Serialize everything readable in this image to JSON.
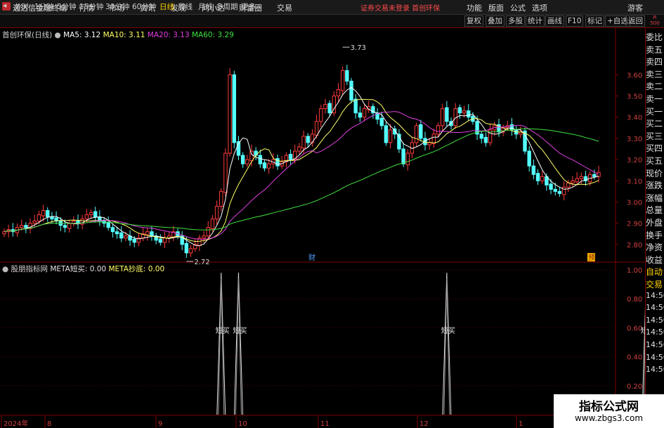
{
  "app": {
    "title": "通达信金融终端"
  },
  "menu": [
    "行情",
    "市场",
    "资讯",
    "发现",
    "问小达",
    "财富圈",
    "交易"
  ],
  "warning": "证券交易未登录  首创环保",
  "right_menu": [
    "功能",
    "版面",
    "公式",
    "选项",
    "游客"
  ],
  "toolbar": {
    "periods": [
      "分时",
      "1分钟",
      "5分钟",
      "15分钟",
      "30分钟",
      "60分钟",
      "日线",
      "周线",
      "月线",
      "多周期",
      "更多"
    ],
    "active": "日线",
    "right": [
      "复权",
      "叠加",
      "多股",
      "统计",
      "画线",
      "F10",
      "标记",
      "+自选",
      "返回"
    ]
  },
  "corner": {
    "line1": "R",
    "line2": "500"
  },
  "stock": {
    "name": "首创环保(日线)"
  },
  "ma": [
    {
      "label": "MA5: 3.12",
      "color": "#ffffff"
    },
    {
      "label": "MA10: 3.11",
      "color": "#ffff66"
    },
    {
      "label": "MA20: 3.13",
      "color": "#e040e0"
    },
    {
      "label": "MA60: 3.29",
      "color": "#40e040"
    }
  ],
  "price_axis": [
    "3.60",
    "3.50",
    "3.40",
    "3.30",
    "3.20",
    "3.10",
    "3.00",
    "2.90",
    "2.80"
  ],
  "high_label": "3.73",
  "low_label": "2.72",
  "event_markers": {
    "cai": "财",
    "yu": "预"
  },
  "indicator": {
    "name": "股朋指标网",
    "line1": "META短买: 0.00",
    "line2": "META抄底: 0.00",
    "signal_label": "短买",
    "bottom_label": "抄底",
    "axis": [
      "1.00",
      "0.80",
      "0.60",
      "0.40",
      "0.20"
    ]
  },
  "date_axis": [
    "2024年",
    "8",
    "9",
    "10",
    "11",
    "12",
    "1"
  ],
  "side_panel": [
    "委比",
    "卖五",
    "卖四",
    "卖三",
    "卖二",
    "卖一",
    "买一",
    "买二",
    "买三",
    "买四",
    "买五",
    "现价",
    "涨跌",
    "涨幅",
    "总量",
    "外盘",
    "换手",
    "净资",
    "收益",
    "自动",
    "交易",
    "14:56",
    "14:56",
    "14:56",
    "14:56",
    "14:56",
    "14:56",
    "14:56"
  ],
  "watermark": {
    "title": "指标公式网",
    "url": "www.zbgs3.com"
  },
  "colors": {
    "up": "#ff3c3c",
    "down": "#54ffff",
    "ma5": "#ffffff",
    "ma10": "#ffff66",
    "ma20": "#e040e0",
    "ma60": "#40e040",
    "border": "#800000"
  },
  "chart_data": {
    "type": "candlestick",
    "ylim": [
      2.7,
      3.8
    ],
    "closes": [
      2.86,
      2.87,
      2.86,
      2.88,
      2.89,
      2.88,
      2.9,
      2.91,
      2.94,
      2.96,
      2.93,
      2.92,
      2.91,
      2.89,
      2.88,
      2.9,
      2.91,
      2.9,
      2.92,
      2.94,
      2.95,
      2.93,
      2.91,
      2.9,
      2.88,
      2.86,
      2.85,
      2.83,
      2.84,
      2.82,
      2.81,
      2.83,
      2.85,
      2.86,
      2.84,
      2.82,
      2.81,
      2.83,
      2.84,
      2.86,
      2.84,
      2.8,
      2.76,
      2.78,
      2.8,
      2.83,
      2.84,
      2.88,
      2.92,
      2.98,
      3.05,
      3.23,
      3.6,
      3.28,
      3.22,
      3.18,
      3.2,
      3.24,
      3.22,
      3.18,
      3.16,
      3.18,
      3.2,
      3.17,
      3.19,
      3.22,
      3.2,
      3.24,
      3.26,
      3.31,
      3.28,
      3.32,
      3.38,
      3.44,
      3.46,
      3.42,
      3.5,
      3.53,
      3.62,
      3.57,
      3.48,
      3.42,
      3.4,
      3.44,
      3.45,
      3.42,
      3.39,
      3.36,
      3.28,
      3.34,
      3.32,
      3.25,
      3.18,
      3.23,
      3.28,
      3.36,
      3.3,
      3.27,
      3.28,
      3.32,
      3.36,
      3.44,
      3.38,
      3.36,
      3.44,
      3.42,
      3.43,
      3.4,
      3.38,
      3.32,
      3.3,
      3.28,
      3.34,
      3.36,
      3.33,
      3.35,
      3.36,
      3.34,
      3.32,
      3.33,
      3.24,
      3.17,
      3.13,
      3.1,
      3.12,
      3.08,
      3.06,
      3.05,
      3.04,
      3.07,
      3.09,
      3.1,
      3.11,
      3.12,
      3.1,
      3.13,
      3.12,
      3.14
    ],
    "signals": [
      50,
      54,
      102,
      148,
      178,
      191,
      193,
      201
    ]
  }
}
